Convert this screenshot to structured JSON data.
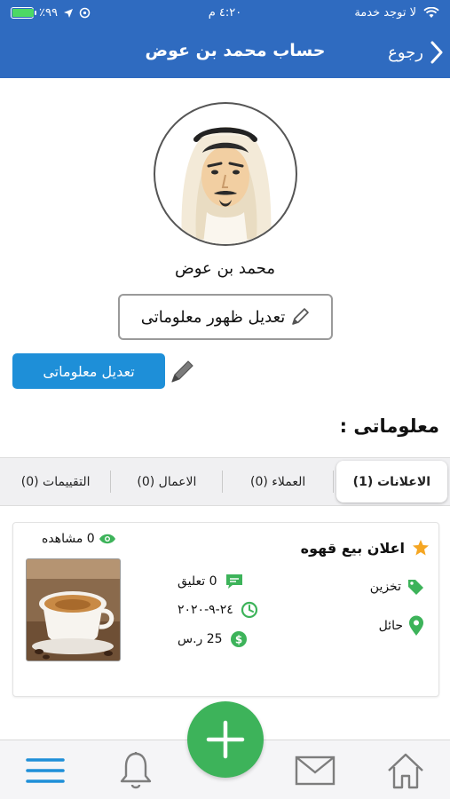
{
  "status_bar": {
    "carrier": "لا توجد خدمة",
    "time": "٤:٢٠ م",
    "battery_percent": "٪٩٩",
    "battery_level": 0.99
  },
  "nav": {
    "title": "حساب محمد بن عوض",
    "back_label": "رجوع"
  },
  "profile": {
    "name": "محمد بن عوض",
    "edit_visibility_label": "تعديل ظهور معلوماتى",
    "edit_info_label": "تعديل معلوماتى"
  },
  "section_title": "معلوماتى :",
  "tabs": [
    {
      "label": "الاعلانات (1)",
      "active": true
    },
    {
      "label": "العملاء (0)",
      "active": false
    },
    {
      "label": "الاعمال (0)",
      "active": false
    },
    {
      "label": "التقييمات (0)",
      "active": false
    }
  ],
  "ad": {
    "title": "اعلان بيع قهوه",
    "category": "تخزين",
    "city": "حائل",
    "views": "0 مشاهده",
    "comments": "0 تعليق",
    "date": "٢٤-٩-٢٠٢٠",
    "price": "25 ر.س"
  },
  "colors": {
    "header": "#2f6bc0",
    "primary_button": "#1e8fd8",
    "green": "#3db35a",
    "star": "#f5a623"
  },
  "bottom_nav": [
    "home-icon",
    "mail-icon",
    "add-icon",
    "bell-icon",
    "menu-icon"
  ]
}
